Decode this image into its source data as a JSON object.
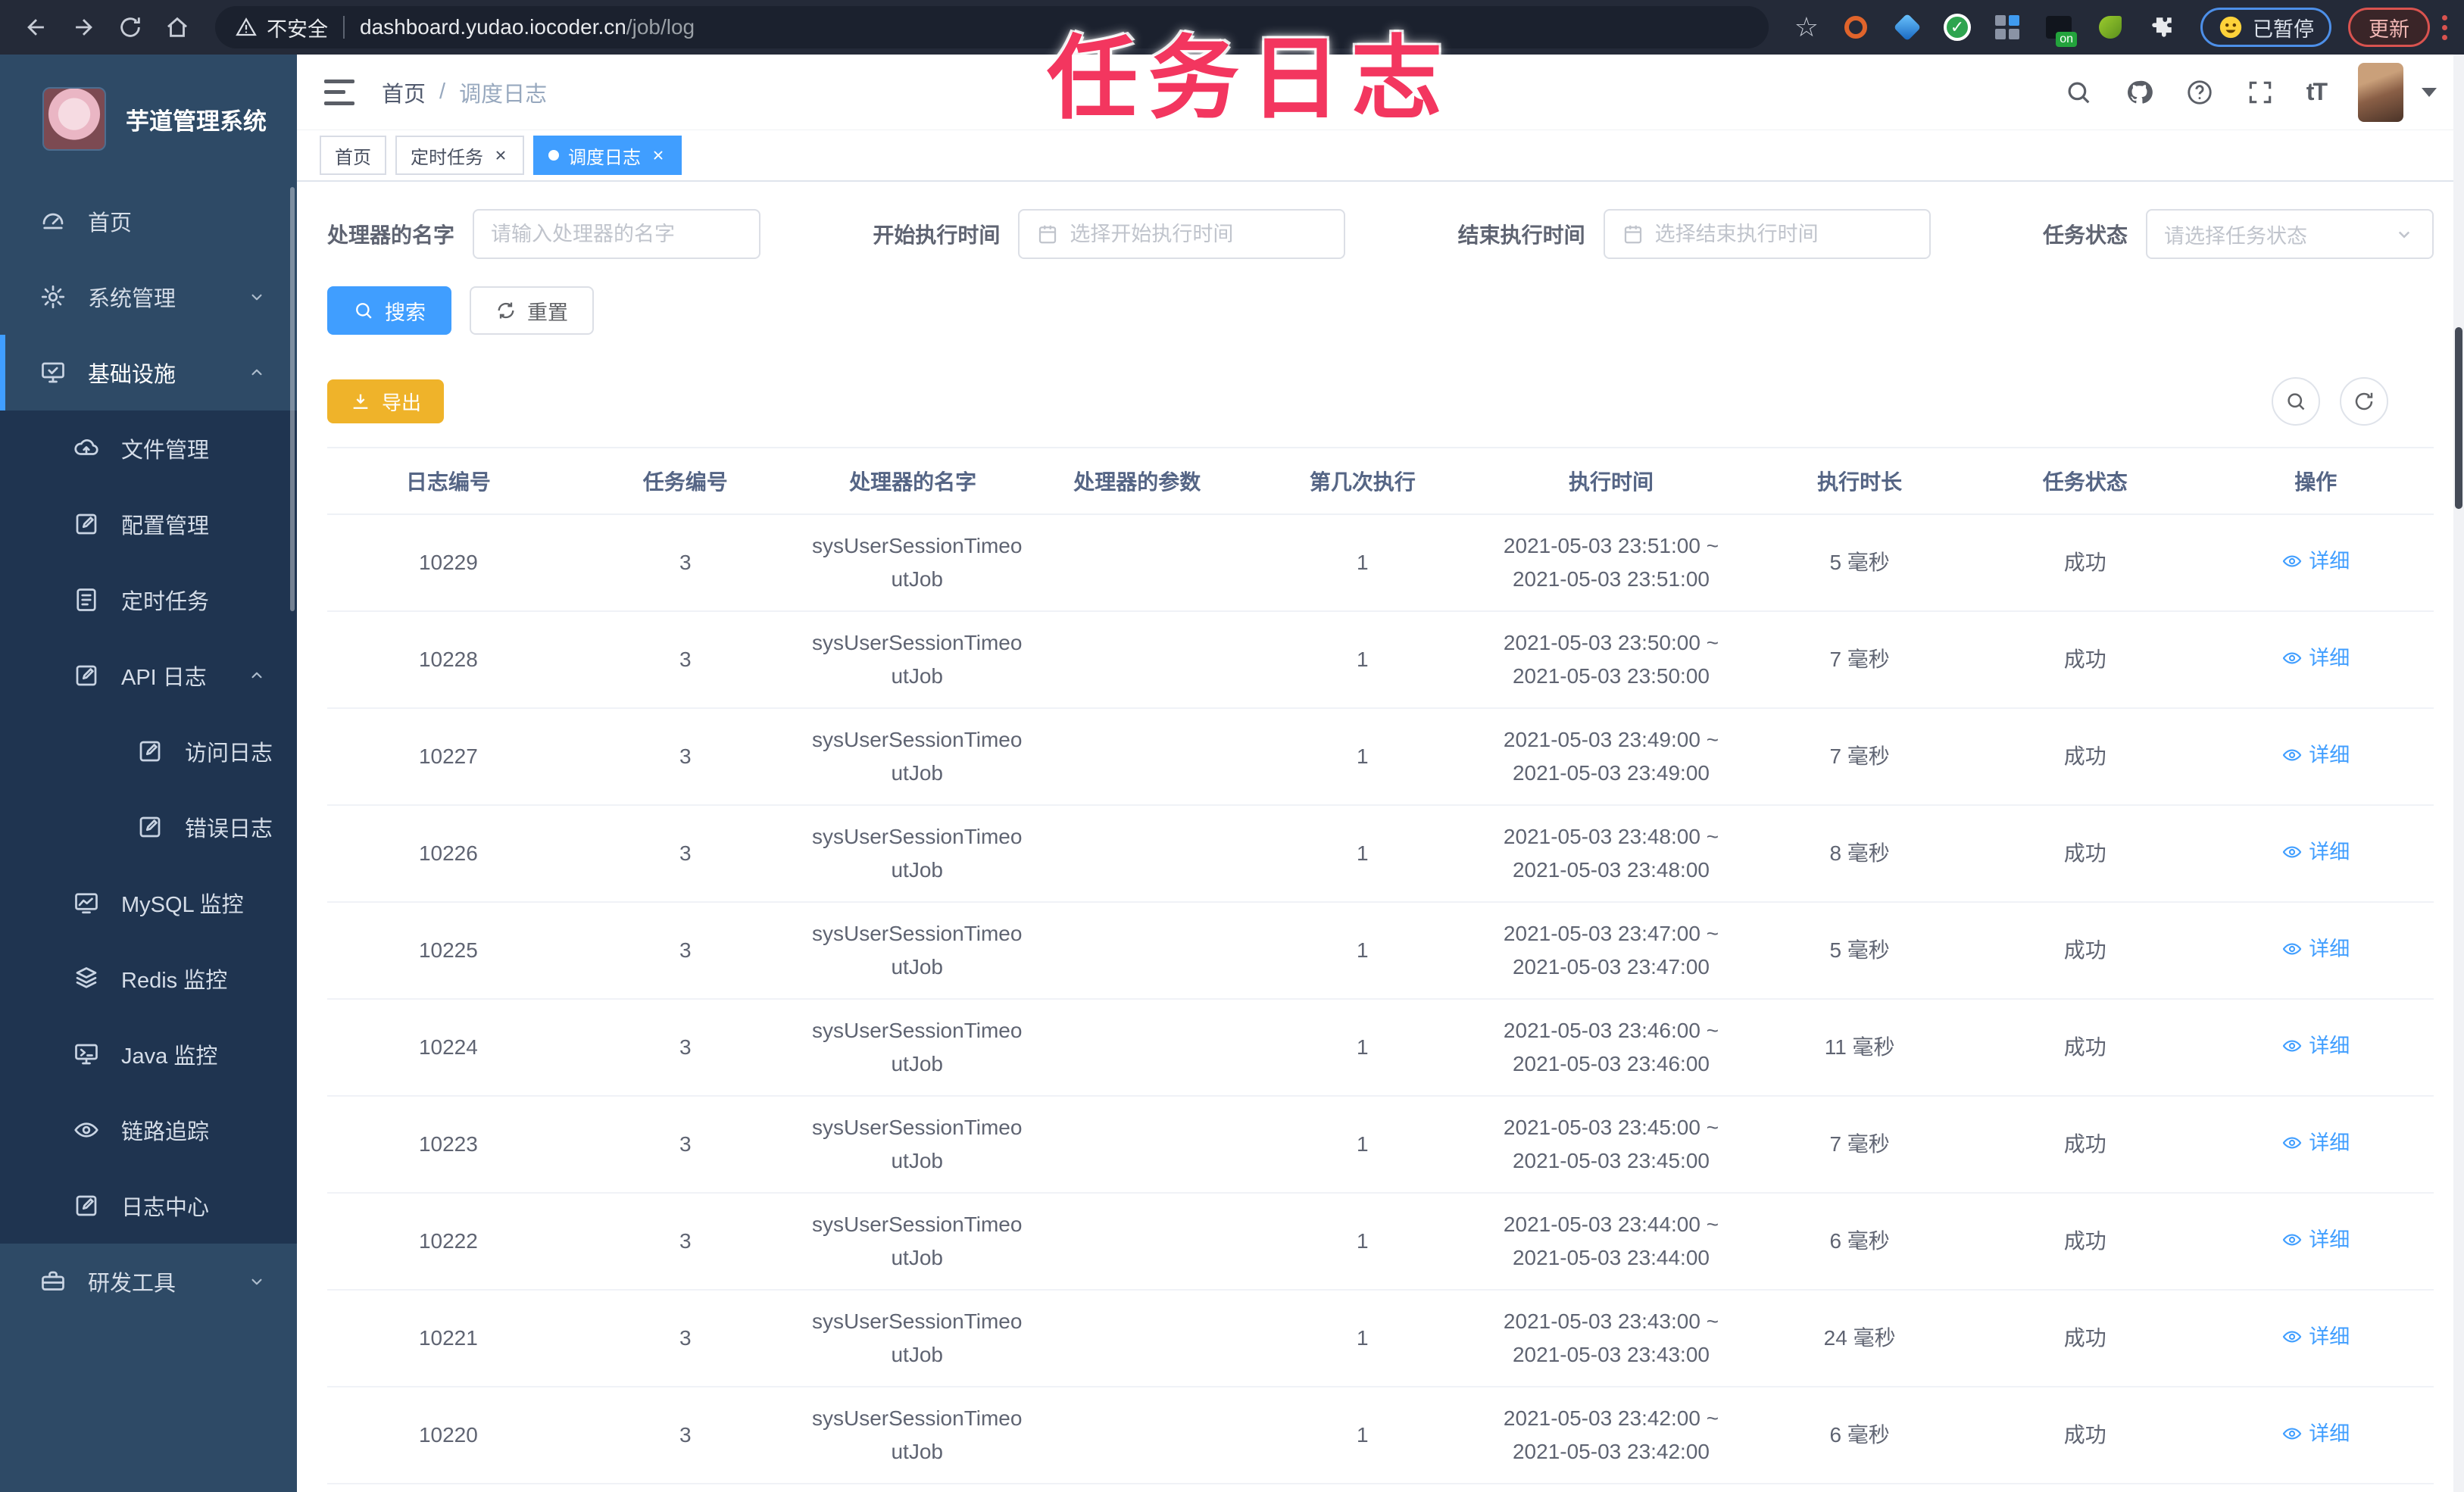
{
  "browser": {
    "security_label": "不安全",
    "url_host": "dashboard.yudao.iocoder.cn",
    "url_path": "/job/log",
    "extension_on_badge": "on",
    "paused_label": "已暂停",
    "update_label": "更新"
  },
  "overlay_title": "任务日志",
  "sidebar": {
    "app_title": "芋道管理系统",
    "items": [
      {
        "label": "首页",
        "icon": "dashboard",
        "level": 0
      },
      {
        "label": "系统管理",
        "icon": "gear",
        "level": 0,
        "chevron": "down"
      },
      {
        "label": "基础设施",
        "icon": "monitor",
        "level": 0,
        "chevron": "up",
        "active": true
      },
      {
        "label": "文件管理",
        "icon": "cloud",
        "level": 1
      },
      {
        "label": "配置管理",
        "icon": "edit",
        "level": 1
      },
      {
        "label": "定时任务",
        "icon": "doc",
        "level": 1
      },
      {
        "label": "API 日志",
        "icon": "edit",
        "level": 1,
        "chevron": "up"
      },
      {
        "label": "访问日志",
        "icon": "edit",
        "level": 2
      },
      {
        "label": "错误日志",
        "icon": "edit",
        "level": 2
      },
      {
        "label": "MySQL 监控",
        "icon": "chart",
        "level": 1
      },
      {
        "label": "Redis 监控",
        "icon": "layers",
        "level": 1
      },
      {
        "label": "Java 监控",
        "icon": "java",
        "level": 1
      },
      {
        "label": "链路追踪",
        "icon": "eye",
        "level": 1
      },
      {
        "label": "日志中心",
        "icon": "edit",
        "level": 1
      },
      {
        "label": "研发工具",
        "icon": "briefcase",
        "level": 0,
        "chevron": "down"
      }
    ]
  },
  "navbar": {
    "breadcrumb_home": "首页",
    "breadcrumb_current": "调度日志",
    "font_icon_text": "tT"
  },
  "tabs": [
    {
      "label": "首页",
      "active": false,
      "closable": false,
      "dot": false
    },
    {
      "label": "定时任务",
      "active": false,
      "closable": true,
      "dot": false
    },
    {
      "label": "调度日志",
      "active": true,
      "closable": true,
      "dot": true
    }
  ],
  "filters": {
    "handler_label": "处理器的名字",
    "handler_placeholder": "请输入处理器的名字",
    "start_label": "开始执行时间",
    "start_placeholder": "选择开始执行时间",
    "end_label": "结束执行时间",
    "end_placeholder": "选择结束执行时间",
    "status_label": "任务状态",
    "status_placeholder": "请选择任务状态"
  },
  "actions": {
    "search": "搜索",
    "reset": "重置",
    "export": "导出"
  },
  "table": {
    "headers": [
      "日志编号",
      "任务编号",
      "处理器的名字",
      "处理器的参数",
      "第几次执行",
      "执行时间",
      "执行时长",
      "任务状态",
      "操作"
    ],
    "action_label": "详细",
    "rows": [
      {
        "log_id": "10229",
        "job_id": "3",
        "handler": "sysUserSessionTimeoutJob",
        "param": "",
        "exec_index": "1",
        "time_start": "2021-05-03 23:51:00",
        "time_end": "2021-05-03 23:51:00",
        "duration": "5 毫秒",
        "status": "成功"
      },
      {
        "log_id": "10228",
        "job_id": "3",
        "handler": "sysUserSessionTimeoutJob",
        "param": "",
        "exec_index": "1",
        "time_start": "2021-05-03 23:50:00",
        "time_end": "2021-05-03 23:50:00",
        "duration": "7 毫秒",
        "status": "成功"
      },
      {
        "log_id": "10227",
        "job_id": "3",
        "handler": "sysUserSessionTimeoutJob",
        "param": "",
        "exec_index": "1",
        "time_start": "2021-05-03 23:49:00",
        "time_end": "2021-05-03 23:49:00",
        "duration": "7 毫秒",
        "status": "成功"
      },
      {
        "log_id": "10226",
        "job_id": "3",
        "handler": "sysUserSessionTimeoutJob",
        "param": "",
        "exec_index": "1",
        "time_start": "2021-05-03 23:48:00",
        "time_end": "2021-05-03 23:48:00",
        "duration": "8 毫秒",
        "status": "成功"
      },
      {
        "log_id": "10225",
        "job_id": "3",
        "handler": "sysUserSessionTimeoutJob",
        "param": "",
        "exec_index": "1",
        "time_start": "2021-05-03 23:47:00",
        "time_end": "2021-05-03 23:47:00",
        "duration": "5 毫秒",
        "status": "成功"
      },
      {
        "log_id": "10224",
        "job_id": "3",
        "handler": "sysUserSessionTimeoutJob",
        "param": "",
        "exec_index": "1",
        "time_start": "2021-05-03 23:46:00",
        "time_end": "2021-05-03 23:46:00",
        "duration": "11 毫秒",
        "status": "成功"
      },
      {
        "log_id": "10223",
        "job_id": "3",
        "handler": "sysUserSessionTimeoutJob",
        "param": "",
        "exec_index": "1",
        "time_start": "2021-05-03 23:45:00",
        "time_end": "2021-05-03 23:45:00",
        "duration": "7 毫秒",
        "status": "成功"
      },
      {
        "log_id": "10222",
        "job_id": "3",
        "handler": "sysUserSessionTimeoutJob",
        "param": "",
        "exec_index": "1",
        "time_start": "2021-05-03 23:44:00",
        "time_end": "2021-05-03 23:44:00",
        "duration": "6 毫秒",
        "status": "成功"
      },
      {
        "log_id": "10221",
        "job_id": "3",
        "handler": "sysUserSessionTimeoutJob",
        "param": "",
        "exec_index": "1",
        "time_start": "2021-05-03 23:43:00",
        "time_end": "2021-05-03 23:43:00",
        "duration": "24 毫秒",
        "status": "成功"
      },
      {
        "log_id": "10220",
        "job_id": "3",
        "handler": "sysUserSessionTimeoutJob",
        "param": "",
        "exec_index": "1",
        "time_start": "2021-05-03 23:42:00",
        "time_end": "2021-05-03 23:42:00",
        "duration": "6 毫秒",
        "status": "成功"
      }
    ]
  },
  "colors": {
    "accent": "#409eff",
    "warning": "#efb32a",
    "overlay_pink": "#f3365f",
    "sidebar": "#2e4a66",
    "sidebar_sub": "#1f3450"
  }
}
